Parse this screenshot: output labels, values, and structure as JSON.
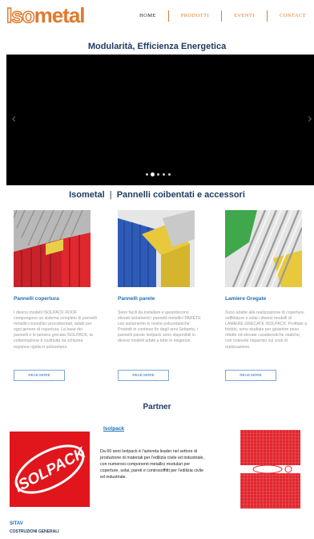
{
  "brand": {
    "logo_part1": "Iso",
    "logo_part2": "metal",
    "color": "#e07a2b"
  },
  "nav": {
    "items": [
      {
        "label": "HOME"
      },
      {
        "label": "PRODOTTI"
      },
      {
        "label": "EVENTI"
      },
      {
        "label": "CONTACT"
      }
    ]
  },
  "top_heading": "Modularità, Efficienza Energetica",
  "slider": {
    "prev_icon": "chevron-left-icon",
    "next_icon": "chevron-right-icon",
    "dots": 5,
    "active_dot": 1
  },
  "section": {
    "brand": "Isometal",
    "separator": "|",
    "subtitle": "Pannelli coibentati e accessori"
  },
  "products": [
    {
      "title": "Pannelli copertura",
      "desc": "I diversi modelli ISOLPACK ROOF compongono un sistema completo di pannelli metallici monolitici precoibentati, adatti per ogni genere di copertura. La base dei pannelli è in lamiera grecata ISOLPACK, la coibentazione è costituita da schiuma espansa rigida in poliuretano.",
      "button": "READ MORE"
    },
    {
      "title": "Pannelli parete",
      "desc": "Sono facili da installare e garantiscono elevati isolamenti i pannelli metallici PARETE con isolamento in resine poliuretaniche Prodotti in continuo fin dagli anni Settanta, i pannelli parete Isolpack sono disponibili in diversi modelli adatti a tutte le esigenze.",
      "button": "READ MORE"
    },
    {
      "title": "Lamiere Gregate",
      "desc": "Sono adatte alla realizzazione di coperture, soffittature e solai i diversi modelli di LAMIERE GRECATE ISOLPACK. Profilate a freddo, sono studiate per garantire peso ridotto ed elevate caratteristiche statiche, con notevole risparmio sui costi di realizzazione.",
      "button": "READ MORE"
    }
  ],
  "partner": {
    "heading": "Partner",
    "name": "Isolpack",
    "logo_text": "ISOLPACK",
    "desc": "Da 60 anni Isolpack è l'azienda leader nel settore di produzione di materiali per l'edilizia civile ed industriale, con numerosi componenti metallici modulari per coperture, solai, pareti e controsoffitti per l'edilizia civile ed industriale."
  },
  "bottom": {
    "name": "SITAV",
    "sub": "COSTRUZIONI GENERALI"
  }
}
